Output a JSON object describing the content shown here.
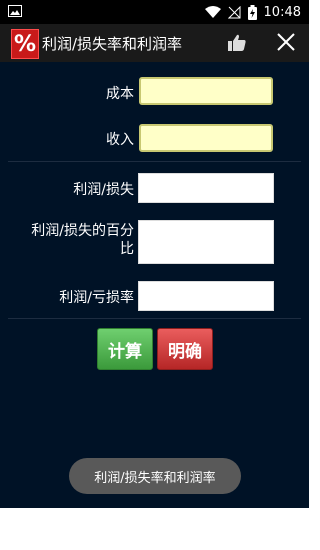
{
  "status_bar": {
    "time": "10:48"
  },
  "app_bar": {
    "logo_text": "%",
    "title": "利润/损失率和利润率",
    "icons": {
      "like": "thumbs-up-icon",
      "close": "close-icon"
    }
  },
  "form": {
    "cost_label": "成本",
    "cost_value": "",
    "revenue_label": "收入",
    "revenue_value": "",
    "profit_loss_label": "利润/损失",
    "profit_loss_value": "",
    "profit_loss_percent_label_line1": "利润/损失的百分",
    "profit_loss_percent_label_line2": "比",
    "profit_loss_percent_value": "",
    "profit_margin_label": "利润/亏损率",
    "profit_margin_value": ""
  },
  "buttons": {
    "calculate": "计算",
    "clear": "明确"
  },
  "toast": {
    "text": "利润/损失率和利润率"
  },
  "colors": {
    "background": "#001226",
    "input_highlight": "#ffffc8",
    "calculate_button": "#4caf50",
    "clear_button": "#d32f2f"
  }
}
